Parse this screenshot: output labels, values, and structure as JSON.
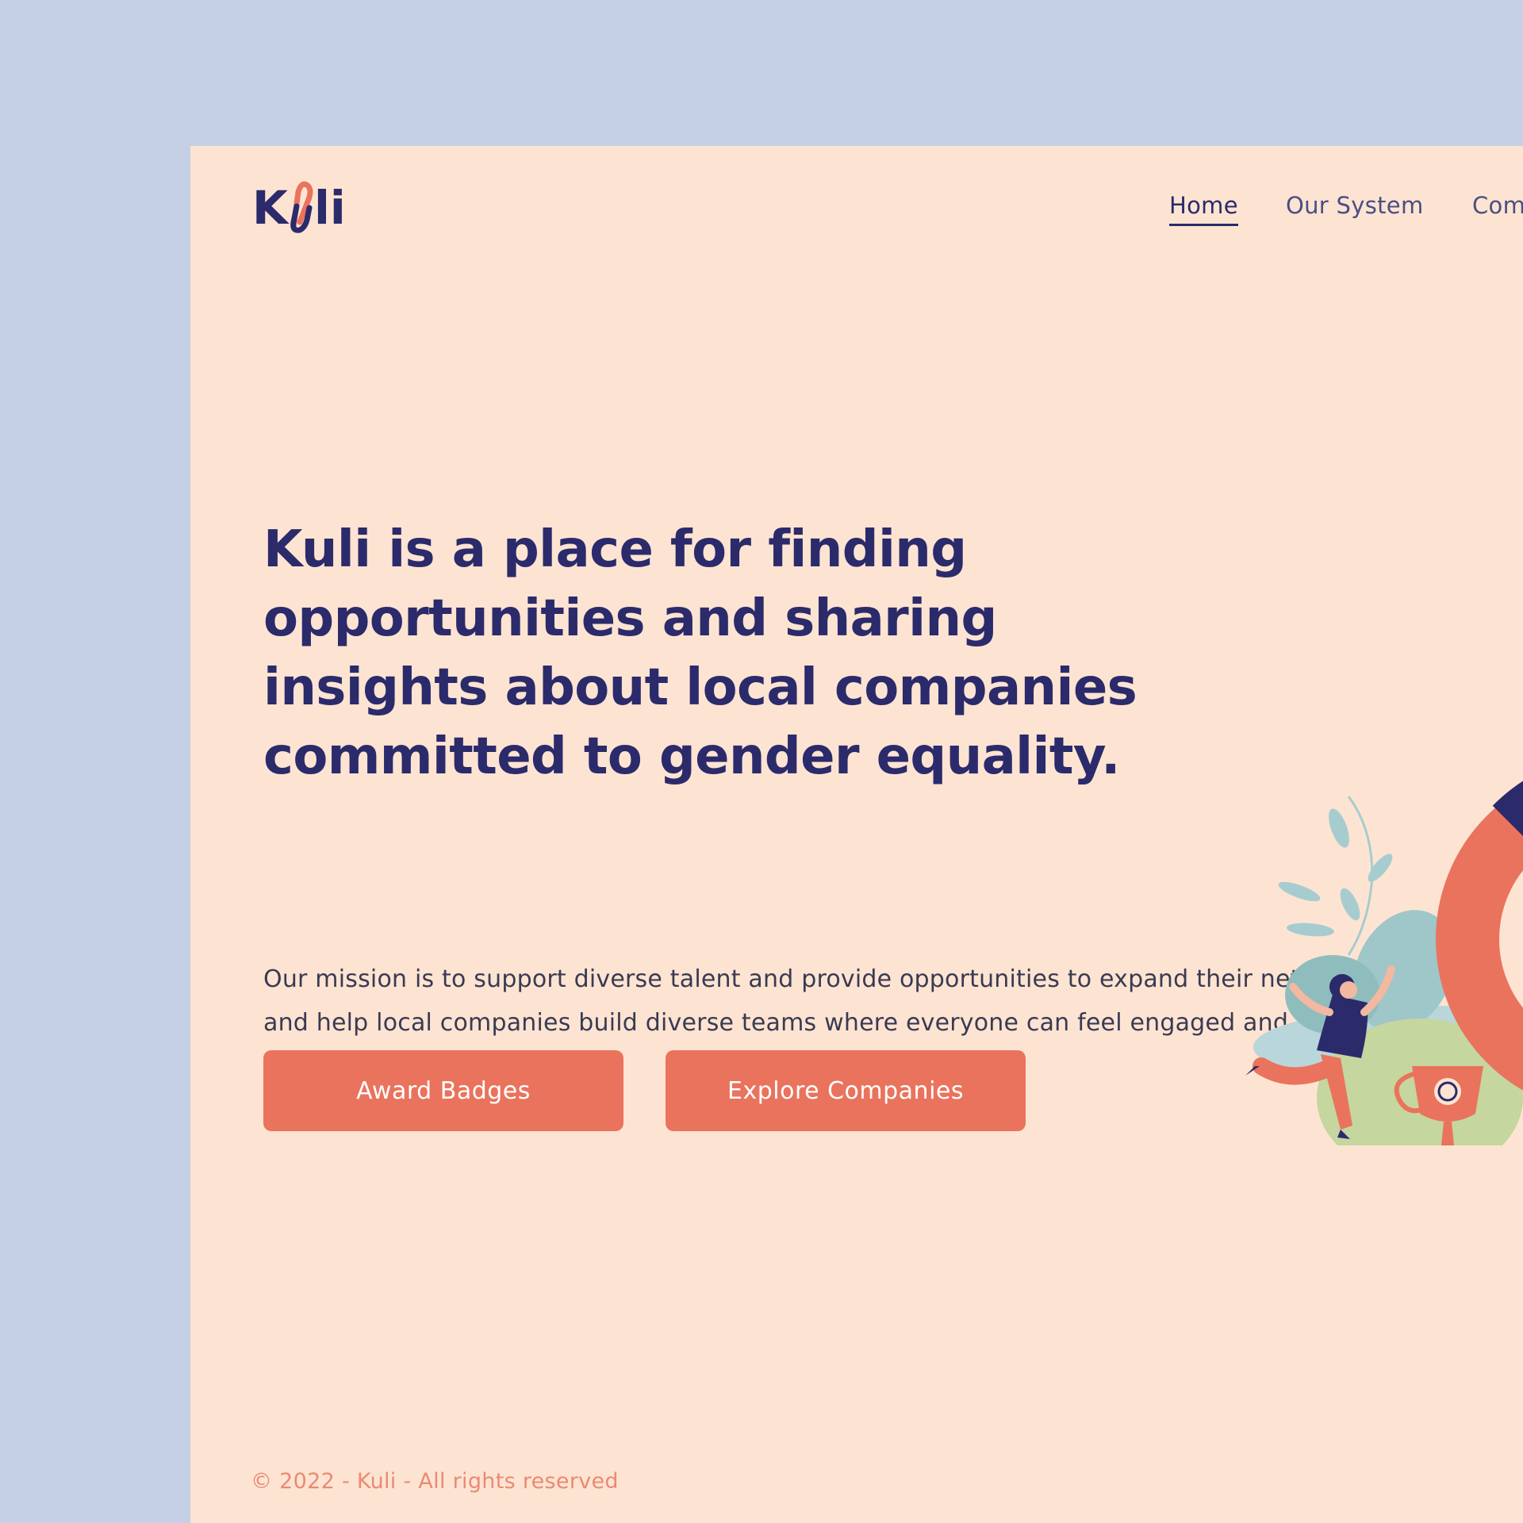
{
  "brand": {
    "logo_text": "Kuli",
    "colors": {
      "primary": "#2b2a6b",
      "accent": "#ea735d",
      "page_bg": "#fde4d2",
      "outer_bg": "#c5cfe5"
    }
  },
  "nav": {
    "items": [
      {
        "label": "Home",
        "active": true
      },
      {
        "label": "Our System",
        "active": false
      },
      {
        "label": "Com",
        "active": false
      }
    ]
  },
  "hero": {
    "headline": "Kuli is a place for finding opportunities and sharing insights about local companies committed to gender equality.",
    "mission": "Our mission is to support diverse talent and provide opportunities to expand their network, and help local companies build diverse teams where everyone can feel engaged and included.",
    "buttons": {
      "award_badges": "Award Badges",
      "explore_companies": "Explore Companies"
    }
  },
  "illustration": {
    "icons": [
      "leaf-plant-icon",
      "celebrating-woman-icon",
      "trophy-badge-icon",
      "donut-ring-icon"
    ]
  },
  "footer": {
    "copyright": "© 2022 - Kuli - All rights reserved"
  }
}
